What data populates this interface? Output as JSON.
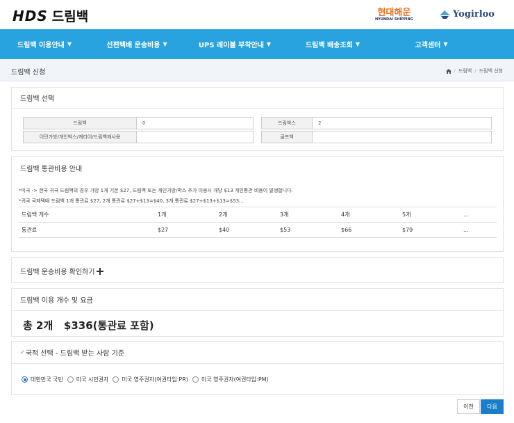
{
  "brand": {
    "logo_text": "HDS",
    "name": "드림백"
  },
  "partners": {
    "hyundai_ko": "현대해운",
    "hyundai_en": "HYUNDAI SHIPPING",
    "yogirloo": "Yogirloo"
  },
  "nav": [
    {
      "label": "드림백 이용안내"
    },
    {
      "label": "선편택배 운송비용"
    },
    {
      "label": "UPS 레이블 부착안내"
    },
    {
      "label": "드림백 배송조회"
    },
    {
      "label": "고객센터"
    }
  ],
  "page": {
    "title": "드림백 신청",
    "breadcrumb": [
      "드림백",
      "드림백 신청"
    ]
  },
  "select_panel": {
    "title": "드림백 선택",
    "fields": [
      {
        "label": "드림백",
        "value": "0"
      },
      {
        "label": "드림박스",
        "value": "2"
      },
      {
        "label": "이민가방/개인박스/캐리어/드림백재사용",
        "value": ""
      },
      {
        "label": "골프백",
        "value": ""
      }
    ]
  },
  "customs_panel": {
    "title": "드림백 통관비용 안내",
    "notes": [
      "*미국 -> 한국 귀국 드림백의 경우 가방 1개 기본 $27, 드림백 또는 개인가방/박스 추가 이용시 개당 $13 개인통관 비용이 발생합니다.",
      "*귀국 국제택배 드림백 1개 통관료 $27, 2개 통관료 $27+$13=$40, 3개 통관료 $27+$13+$13=$53..."
    ],
    "table": {
      "headers": [
        "드림백 개수",
        "1개",
        "2개",
        "3개",
        "4개",
        "5개",
        "..."
      ],
      "row": [
        "통관료",
        "$27",
        "$40",
        "$53",
        "$66",
        "$79",
        "..."
      ]
    }
  },
  "shipping_check": {
    "label": "드림백 운송비용 확인하기",
    "icon": "plus-icon"
  },
  "usage_panel": {
    "title": "드림백 이용 개수 및 요금",
    "total": "총 2개   $336(통관료 포함)"
  },
  "nationality_panel": {
    "check": "✓",
    "title": "국적 선택 - 드림백 받는 사람 기준",
    "options": [
      {
        "label": "대한민국 국민",
        "selected": true
      },
      {
        "label": "미국 시민권자",
        "selected": false
      },
      {
        "label": "미국 영주권자(여권타입:PR)",
        "selected": false
      },
      {
        "label": "미국 영주권자(여권타입:PM)",
        "selected": false
      }
    ]
  },
  "buttons": {
    "prev": "이전",
    "next": "다음"
  },
  "colors": {
    "nav_bg": "#29a3df",
    "accent": "#1a7fc9",
    "check_red": "#d93a2b",
    "hyundai_orange": "#e8731f"
  }
}
